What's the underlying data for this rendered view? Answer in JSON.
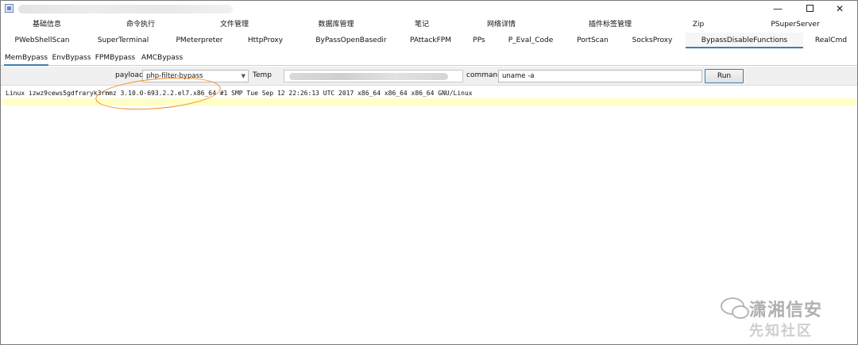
{
  "window": {
    "minimize": "—",
    "close": "✕"
  },
  "tabs_row1": [
    "基础信息",
    "命令执行",
    "文件管理",
    "数据库管理",
    "笔记",
    "网络详情",
    "插件标签管理",
    "Zip",
    "PSuperServer"
  ],
  "tabs_row2": [
    "PWebShellScan",
    "SuperTerminal",
    "PMeterpreter",
    "HttpProxy",
    "ByPassOpenBasedir",
    "PAttackFPM",
    "PPs",
    "P_Eval_Code",
    "PortScan",
    "SocksProxy",
    "BypassDisableFunctions",
    "RealCmd"
  ],
  "active_tab_row2": "BypassDisableFunctions",
  "subtabs": [
    "MemBypass",
    "EnvBypass",
    "FPMBypass",
    "AMCBypass"
  ],
  "active_subtab": "MemBypass",
  "form": {
    "payload_label": "payload",
    "payload_value": "php-filter-bypass",
    "temp_label": "Temp",
    "command_label": "command",
    "command_value": "uname -a",
    "run_label": "Run"
  },
  "output": {
    "line1": "Linux izwz9cews5gdfraryk3rmmz 3.10.0-693.2.2.el7.x86_64 #1 SMP Tue Sep 12 22:26:13 UTC 2017 x86_64 x86_64 x86_64 GNU/Linux"
  },
  "watermark": {
    "text": "潇湘信安",
    "sub": "先知社区"
  },
  "colors": {
    "accent": "#3c7fb1",
    "annotation": "#f28a22",
    "highlight": "#ffffc6"
  }
}
